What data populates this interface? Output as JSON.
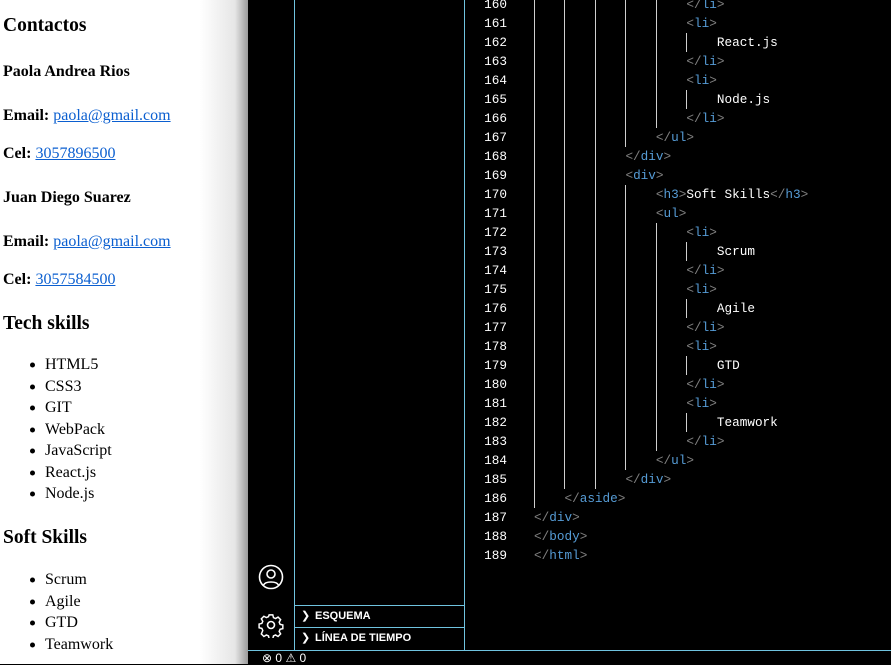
{
  "preview": {
    "contacts_title": "Contactos",
    "contacts": [
      {
        "name": "Paola Andrea Rios",
        "email_label": "Email:",
        "email": "paola@gmail.com",
        "cel_label": "Cel:",
        "cel": "3057896500"
      },
      {
        "name": "Juan Diego Suarez",
        "email_label": "Email:",
        "email": "paola@gmail.com",
        "cel_label": "Cel:",
        "cel": "3057584500"
      }
    ],
    "tech_title": "Tech skills",
    "tech": [
      "HTML5",
      "CSS3",
      "GIT",
      "WebPack",
      "JavaScript",
      "React.js",
      "Node.js"
    ],
    "soft_title": "Soft Skills",
    "soft": [
      "Scrum",
      "Agile",
      "GTD",
      "Teamwork"
    ]
  },
  "activity_bar": {
    "icons": [
      "account-icon",
      "settings-gear-icon"
    ]
  },
  "side_panel": {
    "sections": [
      {
        "label": "ESQUEMA"
      },
      {
        "label": "LÍNEA DE TIEMPO"
      }
    ]
  },
  "colors": {
    "tag": "#569cd6",
    "bracket": "#808080",
    "border": "#6fc3df",
    "link": "#0b5fd0"
  },
  "editor": {
    "lines": [
      {
        "n": "160",
        "indent": 5,
        "text": "</li>"
      },
      {
        "n": "161",
        "indent": 5,
        "text": "<li>"
      },
      {
        "n": "162",
        "indent": 6,
        "text": "React.js"
      },
      {
        "n": "163",
        "indent": 5,
        "text": "</li>"
      },
      {
        "n": "164",
        "indent": 5,
        "text": "<li>"
      },
      {
        "n": "165",
        "indent": 6,
        "text": "Node.js"
      },
      {
        "n": "166",
        "indent": 5,
        "text": "</li>"
      },
      {
        "n": "167",
        "indent": 4,
        "text": "</ul>"
      },
      {
        "n": "168",
        "indent": 3,
        "text": "</div>"
      },
      {
        "n": "169",
        "indent": 3,
        "text": "<div>"
      },
      {
        "n": "170",
        "indent": 4,
        "text": "<h3>Soft Skills</h3>"
      },
      {
        "n": "171",
        "indent": 4,
        "text": "<ul>"
      },
      {
        "n": "172",
        "indent": 5,
        "text": "<li>"
      },
      {
        "n": "173",
        "indent": 6,
        "text": "Scrum"
      },
      {
        "n": "174",
        "indent": 5,
        "text": "</li>"
      },
      {
        "n": "175",
        "indent": 5,
        "text": "<li>"
      },
      {
        "n": "176",
        "indent": 6,
        "text": "Agile"
      },
      {
        "n": "177",
        "indent": 5,
        "text": "</li>"
      },
      {
        "n": "178",
        "indent": 5,
        "text": "<li>"
      },
      {
        "n": "179",
        "indent": 6,
        "text": "GTD"
      },
      {
        "n": "180",
        "indent": 5,
        "text": "</li>"
      },
      {
        "n": "181",
        "indent": 5,
        "text": "<li>"
      },
      {
        "n": "182",
        "indent": 6,
        "text": "Teamwork"
      },
      {
        "n": "183",
        "indent": 5,
        "text": "</li>"
      },
      {
        "n": "184",
        "indent": 4,
        "text": "</ul>"
      },
      {
        "n": "185",
        "indent": 3,
        "text": "</div>"
      },
      {
        "n": "186",
        "indent": 1,
        "text": "</aside>"
      },
      {
        "n": "187",
        "indent": 0,
        "text": "</div>"
      },
      {
        "n": "188",
        "indent": 0,
        "text": "</body>"
      },
      {
        "n": "189",
        "indent": 0,
        "text": "</html>"
      }
    ]
  },
  "status_bar": {
    "errors": "0",
    "warnings": "0"
  }
}
